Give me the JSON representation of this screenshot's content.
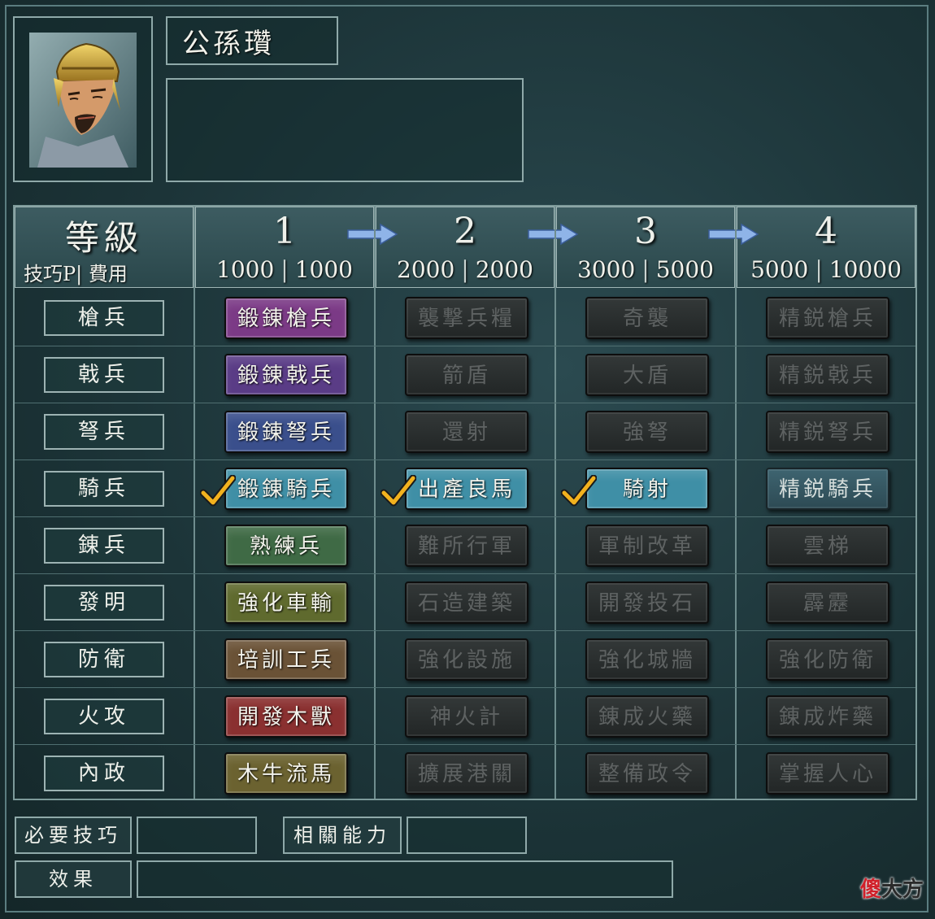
{
  "character": {
    "name": "公孫瓚",
    "portrait": "general-portrait"
  },
  "header": {
    "title": "等級",
    "subtitle": "技巧P| 費用",
    "levels": [
      {
        "level": "1",
        "tech_points": "1000",
        "cost": "1000"
      },
      {
        "level": "2",
        "tech_points": "2000",
        "cost": "2000"
      },
      {
        "level": "3",
        "tech_points": "3000",
        "cost": "5000"
      },
      {
        "level": "4",
        "tech_points": "5000",
        "cost": "10000"
      }
    ]
  },
  "rows": [
    {
      "category": "槍兵",
      "techs": [
        "鍛錬槍兵",
        "襲撃兵糧",
        "奇襲",
        "精鋭槍兵"
      ]
    },
    {
      "category": "戟兵",
      "techs": [
        "鍛錬戟兵",
        "箭盾",
        "大盾",
        "精鋭戟兵"
      ]
    },
    {
      "category": "弩兵",
      "techs": [
        "鍛錬弩兵",
        "還射",
        "強弩",
        "精鋭弩兵"
      ]
    },
    {
      "category": "騎兵",
      "techs": [
        "鍛錬騎兵",
        "出產良馬",
        "騎射",
        "精鋭騎兵"
      ]
    },
    {
      "category": "錬兵",
      "techs": [
        "熟練兵",
        "難所行軍",
        "軍制改革",
        "雲梯"
      ]
    },
    {
      "category": "發明",
      "techs": [
        "強化車輸",
        "石造建築",
        "開發投石",
        "霹靂"
      ]
    },
    {
      "category": "防衛",
      "techs": [
        "培訓工兵",
        "強化設施",
        "強化城牆",
        "強化防衛"
      ]
    },
    {
      "category": "火攻",
      "techs": [
        "開發木獸",
        "神火計",
        "錬成火藥",
        "錬成炸藥"
      ]
    },
    {
      "category": "內政",
      "techs": [
        "木牛流馬",
        "擴展港關",
        "整備政令",
        "掌握人心"
      ]
    }
  ],
  "row_colors": [
    "#7b3a86",
    "#5a3c86",
    "#3a4f8c",
    "#3f8fa6",
    "#3f6a45",
    "#5f6a2e",
    "#6a5236",
    "#8a3030",
    "#6b6230"
  ],
  "researched": [
    [
      3,
      0
    ],
    [
      3,
      1
    ],
    [
      3,
      2
    ]
  ],
  "footer": {
    "required_label": "必要技巧",
    "related_label": "相關能力",
    "effect_label": "效果"
  },
  "watermark": {
    "first": "傻",
    "rest": "大方"
  }
}
